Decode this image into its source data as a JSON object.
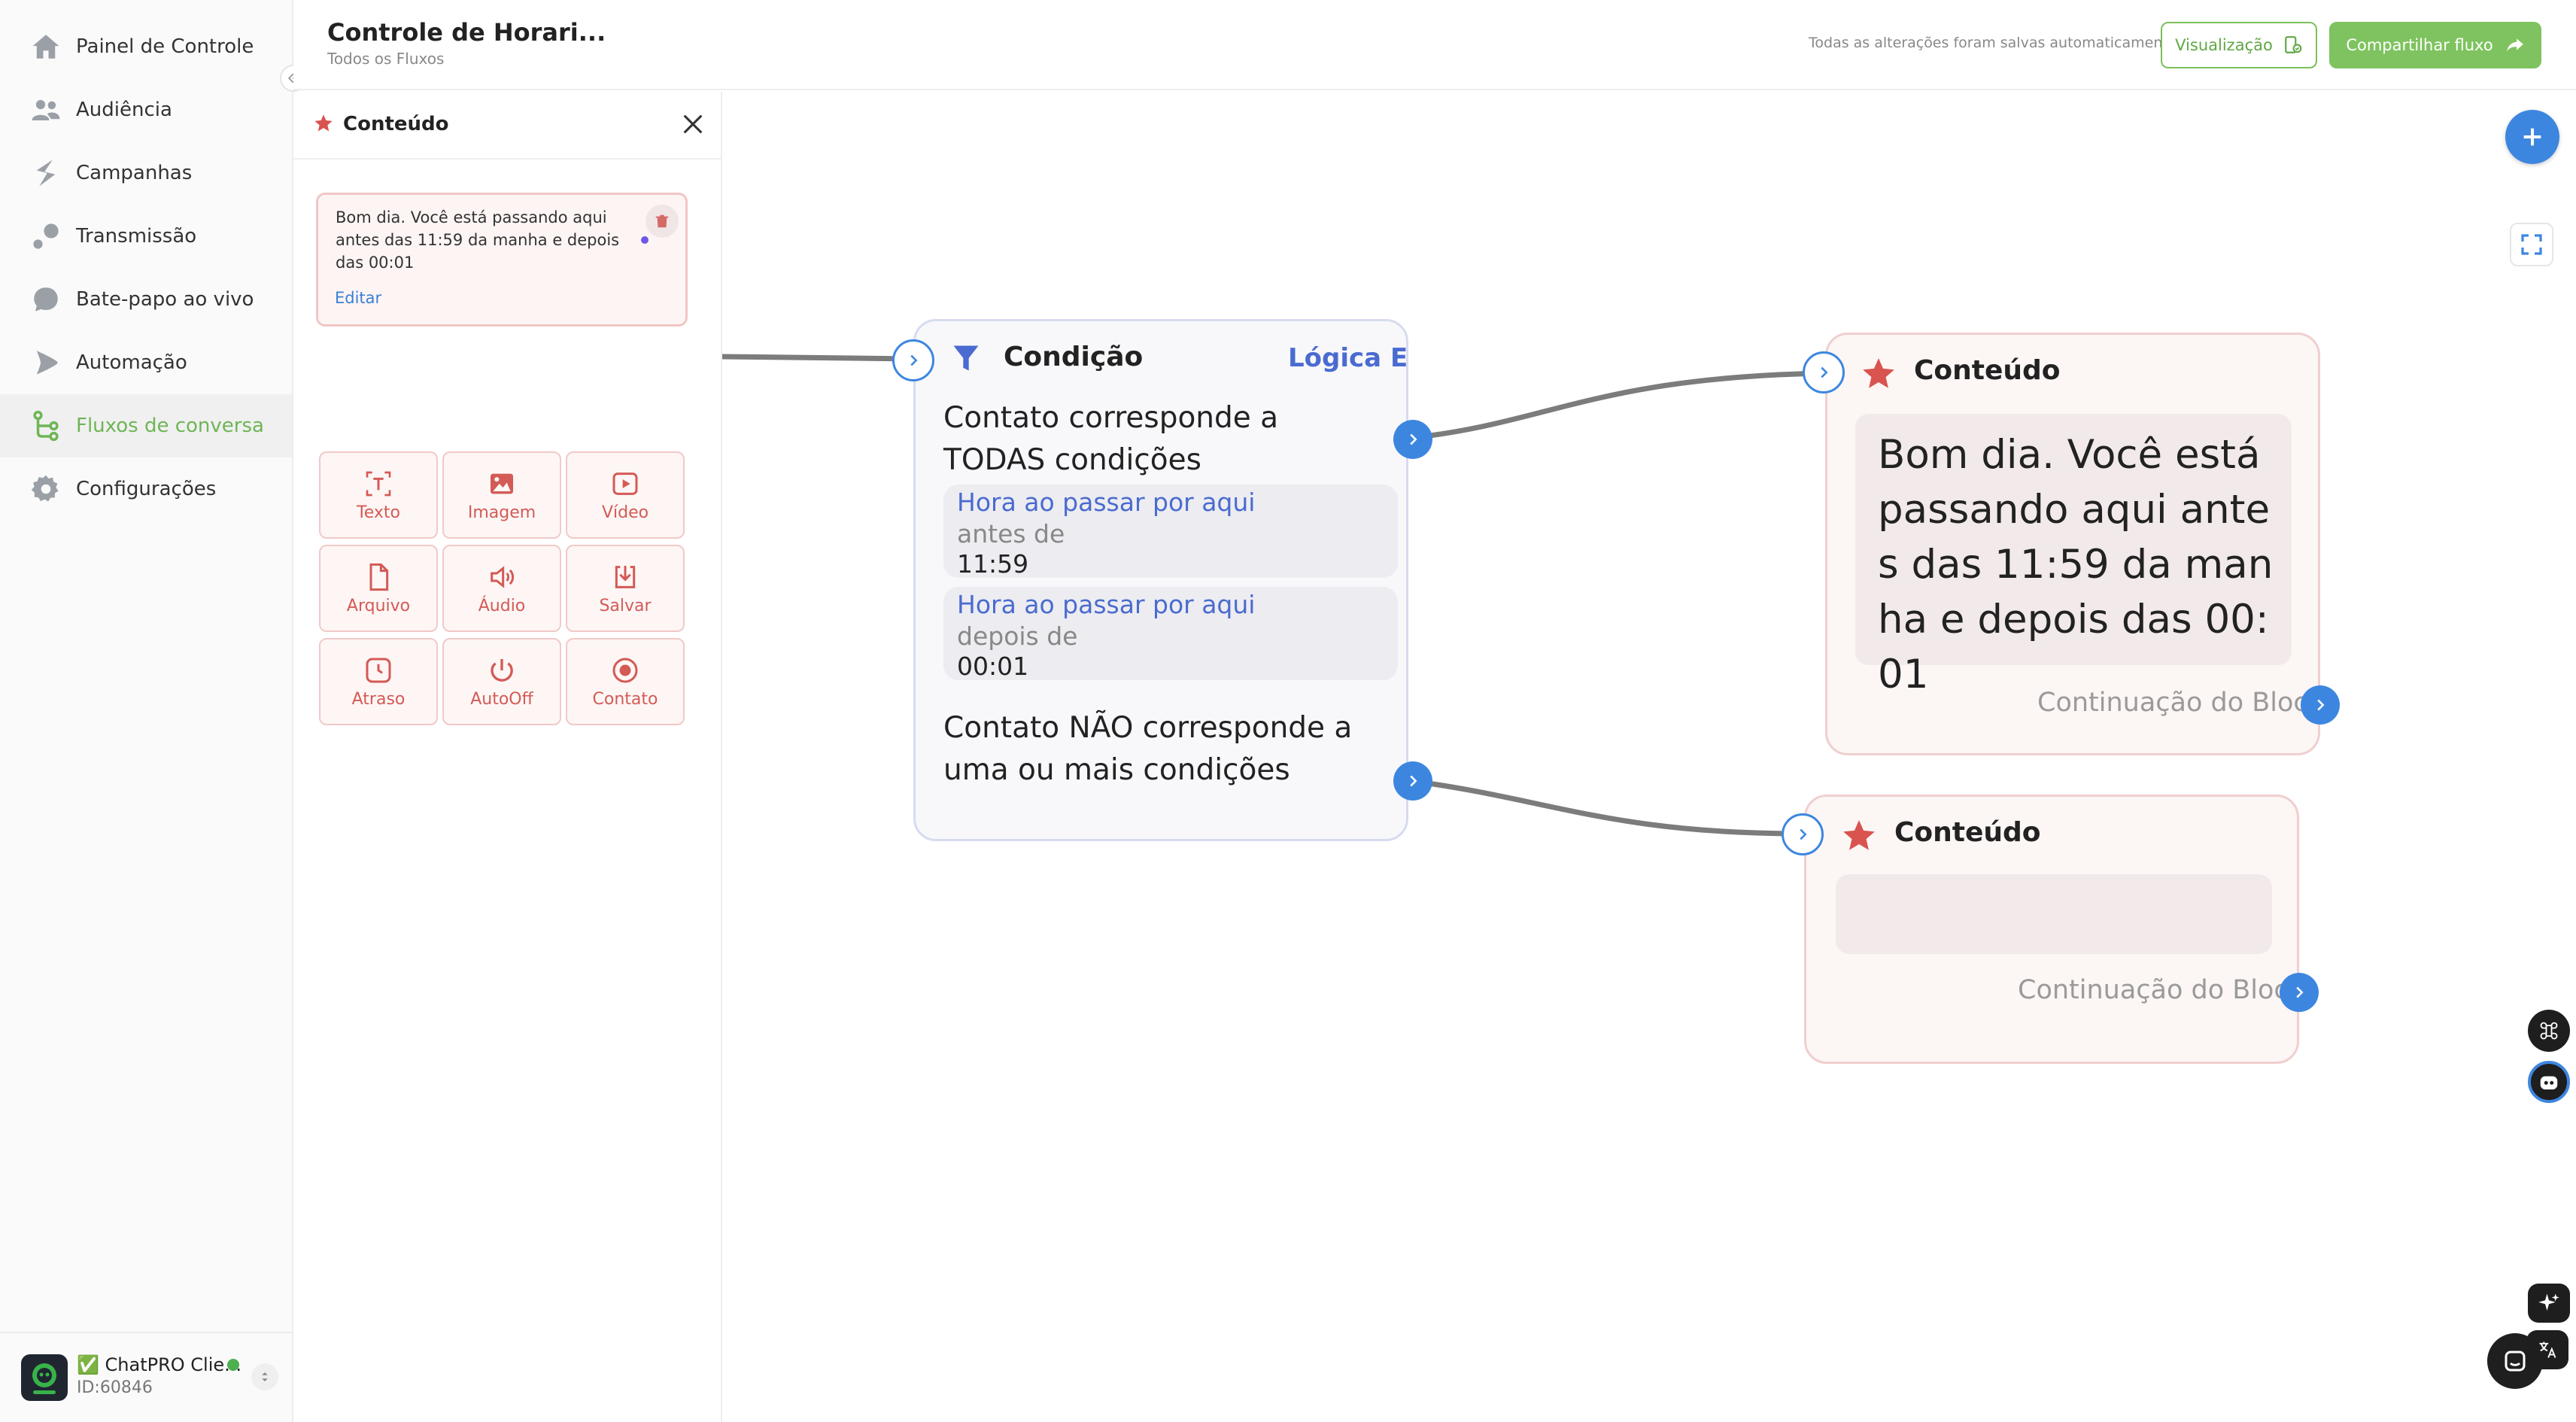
{
  "header": {
    "flow_title": "Controle de Horari...",
    "breadcrumb": "Todos os Fluxos",
    "autosave_status": "Todas as alterações foram salvas automaticamente",
    "preview_label": "Visualização",
    "share_label": "Compartilhar fluxo"
  },
  "sidebar": {
    "items": [
      {
        "label": "Painel de Controle",
        "icon": "home-icon"
      },
      {
        "label": "Audiência",
        "icon": "users-icon"
      },
      {
        "label": "Campanhas",
        "icon": "campaign-icon"
      },
      {
        "label": "Transmissão",
        "icon": "broadcast-icon"
      },
      {
        "label": "Bate-papo ao vivo",
        "icon": "chat-bubble-icon"
      },
      {
        "label": "Automação",
        "icon": "automation-icon"
      },
      {
        "label": "Fluxos de conversa",
        "icon": "flow-icon",
        "active": true
      },
      {
        "label": "Configurações",
        "icon": "gear-icon"
      }
    ],
    "account": {
      "name": "✅ ChatPRO Clie...",
      "id": "ID:60846"
    }
  },
  "panel": {
    "title": "Conteúdo",
    "message_text": "Bom dia. Você está passando aqui antes das 11:59 da manha e depois das 00:01",
    "edit_label": "Editar",
    "tools": [
      {
        "label": "Texto",
        "icon": "text-icon"
      },
      {
        "label": "Imagem",
        "icon": "image-icon"
      },
      {
        "label": "Vídeo",
        "icon": "video-icon"
      },
      {
        "label": "Arquivo",
        "icon": "file-icon"
      },
      {
        "label": "Áudio",
        "icon": "audio-icon"
      },
      {
        "label": "Salvar",
        "icon": "save-icon"
      },
      {
        "label": "Atraso",
        "icon": "clock-icon"
      },
      {
        "label": "AutoOff",
        "icon": "power-icon"
      },
      {
        "label": "Contato",
        "icon": "contact-icon"
      }
    ]
  },
  "canvas": {
    "condition_node": {
      "title": "Condição",
      "logic": "Lógica E",
      "match_all": "Contato corresponde a TODAS condições",
      "rules": [
        {
          "title": "Hora ao passar por aqui",
          "operator": "antes de",
          "value": "11:59"
        },
        {
          "title": "Hora ao passar por aqui",
          "operator": "depois de",
          "value": "00:01"
        }
      ],
      "not_match": "Contato NÃO corresponde a uma ou mais condições"
    },
    "content_node_1": {
      "title": "Conteúdo",
      "message": "Bom dia. Você está passando aqui antes das 11:59 da manha e depois das 00:01",
      "continue_label": "Continuação do Bloco"
    },
    "content_node_2": {
      "title": "Conteúdo",
      "message": "",
      "continue_label": "Continuação do Bloco"
    }
  },
  "colors": {
    "brand_green": "#7ec35f",
    "node_blue": "#3d86e0",
    "content_red": "#d9534f",
    "logic_blue": "#4a6bcf"
  }
}
